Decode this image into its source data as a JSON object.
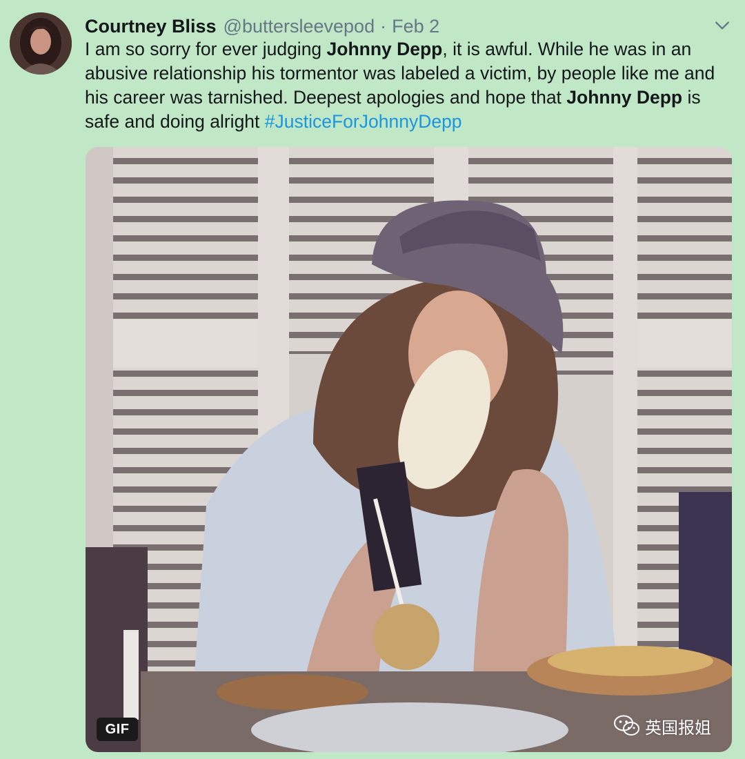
{
  "tweet": {
    "author": {
      "display_name": "Courtney Bliss",
      "handle": "@buttersleevepod",
      "avatar": "profile-photo"
    },
    "separator": "·",
    "date": "Feb 2",
    "menu_icon": "chevron-down-icon",
    "text": {
      "p1": "I am so sorry for ever judging ",
      "b1": "Johnny Depp",
      "p2": ", it is awful. While he was in an abusive relationship his tormentor was labeled a victim, by people like me and his career was tarnished. Deepest apologies and hope that ",
      "b2": "Johnny Depp",
      "p3": " is safe and doing alright ",
      "hashtag": "#JusticeForJohnnyDepp"
    },
    "media": {
      "type": "gif",
      "badge": "GIF",
      "description_icon": "gif-frame"
    }
  },
  "watermark": {
    "icon": "wechat-icon",
    "text": "英国报姐"
  },
  "colors": {
    "background": "#c1e8c6",
    "name": "#14171a",
    "secondary": "#657786",
    "hashtag": "#1b95e0"
  }
}
